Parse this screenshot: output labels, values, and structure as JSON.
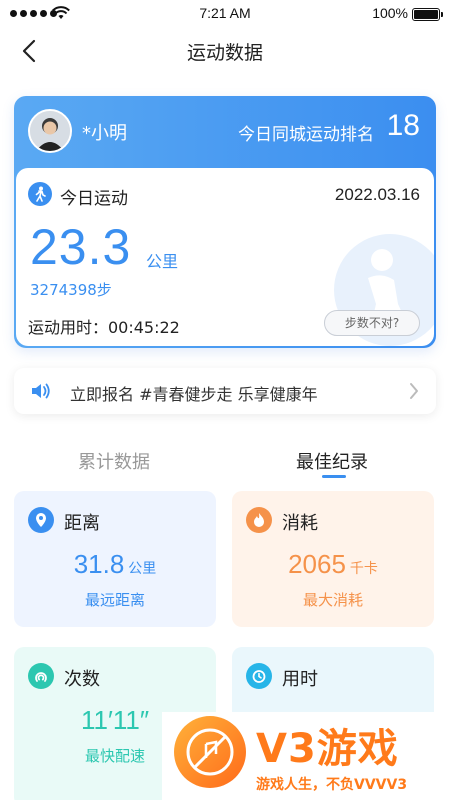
{
  "status_bar": {
    "time": "7:21 AM",
    "battery": "100%"
  },
  "nav": {
    "title": "运动数据"
  },
  "profile": {
    "username": "*小明",
    "rank_label": "今日同城运动排名",
    "rank_value": "18"
  },
  "today": {
    "label": "今日运动",
    "date": "2022.03.16",
    "distance": "23.3",
    "distance_unit": "公里",
    "steps": "3274398步",
    "duration": "运动用时：00:45:22",
    "steps_wrong": "步数不对?"
  },
  "announcement": {
    "text": "立即报名 #青春健步走 乐享健康年"
  },
  "tabs": [
    {
      "label": "累计数据",
      "active": false
    },
    {
      "label": "最佳纪录",
      "active": true
    }
  ],
  "cards": {
    "distance": {
      "title": "距离",
      "value": "31.8",
      "unit": "公里",
      "sub": "最远距离",
      "color": "#3a8ff0"
    },
    "calories": {
      "title": "消耗",
      "value": "2065",
      "unit": "千卡",
      "sub": "最大消耗",
      "color": "#f5924a"
    },
    "count": {
      "title": "次数",
      "value": "11′11″",
      "sub": "最快配速",
      "color": "#2cc7b0"
    },
    "time": {
      "title": "用时",
      "color": "#27b5e8"
    }
  },
  "watermark": {
    "title": "V3游戏",
    "subtitle": "游戏人生，不负VVVV3"
  },
  "icons": [
    "back-icon",
    "walk-icon",
    "speaker-icon",
    "chevron-right-icon",
    "location-icon",
    "flame-icon",
    "signal-icon",
    "clock-icon",
    "wifi-icon",
    "battery-icon"
  ]
}
